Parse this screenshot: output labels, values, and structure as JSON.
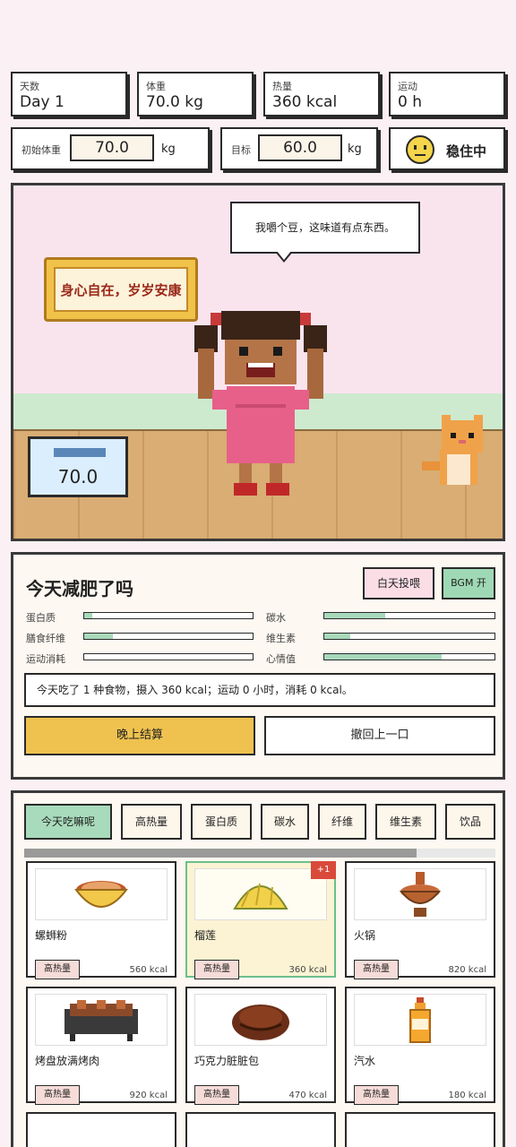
{
  "stats": {
    "day_label": "天数",
    "day_value": "Day 1",
    "weight_label": "体重",
    "weight_value": "70.0 kg",
    "calories_label": "热量",
    "calories_value": "360 kcal",
    "exercise_label": "运动",
    "exercise_value": "0 h"
  },
  "settings": {
    "initial_label": "初始体重",
    "initial_value": "70.0",
    "initial_unit": "kg",
    "target_label": "目标",
    "target_value": "60.0",
    "target_unit": "kg",
    "status_text": "稳住中"
  },
  "scene": {
    "speech": "我嚼个豆，这味道有点东西。",
    "plaque": "身心自在，岁岁安康",
    "scale_value": "70.0"
  },
  "panel": {
    "title": "今天减肥了吗",
    "feed_button": "白天投喂",
    "bgm_button": "BGM 开",
    "bars": [
      {
        "label": "蛋白质",
        "fill": 0.05
      },
      {
        "label": "碳水",
        "fill": 0.36
      },
      {
        "label": "膳食纤维",
        "fill": 0.17
      },
      {
        "label": "维生素",
        "fill": 0.15
      },
      {
        "label": "运动消耗",
        "fill": 0.0
      },
      {
        "label": "心情值",
        "fill": 0.69
      }
    ],
    "summary": "今天吃了 1 种食物，摄入 360 kcal；运动 0 小时，消耗 0 kcal。",
    "settle_button": "晚上结算",
    "undo_button": "撤回上一口"
  },
  "tabs": [
    "今天吃嘛呢",
    "高热量",
    "蛋白质",
    "碳水",
    "纤维",
    "维生素",
    "饮品"
  ],
  "foods": [
    {
      "name": "螺蛳粉",
      "tag": "高热量",
      "kcal": "560 kcal",
      "icon": "noodle-bowl-icon"
    },
    {
      "name": "榴莲",
      "tag": "高热量",
      "kcal": "360 kcal",
      "icon": "durian-icon",
      "badge": "+1"
    },
    {
      "name": "火锅",
      "tag": "高热量",
      "kcal": "820 kcal",
      "icon": "hotpot-icon"
    },
    {
      "name": "烤盘放满烤肉",
      "tag": "高热量",
      "kcal": "920 kcal",
      "icon": "bbq-grill-icon"
    },
    {
      "name": "巧克力脏脏包",
      "tag": "高热量",
      "kcal": "470 kcal",
      "icon": "chocolate-bun-icon"
    },
    {
      "name": "汽水",
      "tag": "高热量",
      "kcal": "180 kcal",
      "icon": "soda-bottle-icon"
    }
  ],
  "colors": {
    "accent_green": "#a8dbbb",
    "accent_yellow": "#efc24f",
    "accent_pink": "#fbdde6",
    "badge_red": "#d94a3a"
  }
}
